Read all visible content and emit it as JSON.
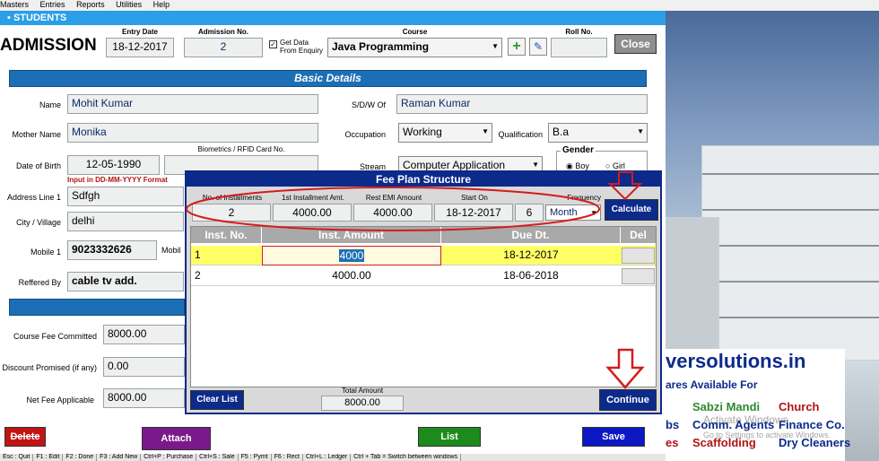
{
  "menu": [
    "Masters",
    "Entries",
    "Reports",
    "Utilities",
    "Help"
  ],
  "window_title": "STUDENTS",
  "form_title": "ADMISSION",
  "header": {
    "entry_date_label": "Entry Date",
    "entry_date": "18-12-2017",
    "admission_no_label": "Admission No.",
    "admission_no": "2",
    "get_data_label": "Get Data\nFrom Enquiry",
    "course_label": "Course",
    "course": "Java Programming",
    "roll_no_label": "Roll No.",
    "roll_no": "",
    "close_label": "Close"
  },
  "basic_details": "Basic Details",
  "fields": {
    "name_label": "Name",
    "name": "Mohit Kumar",
    "sdw_label": "S/D/W Of",
    "sdw": "Raman Kumar",
    "mother_label": "Mother Name",
    "mother": "Monika",
    "occupation_label": "Occupation",
    "occupation": "Working",
    "qualification_label": "Qualification",
    "qualification": "B.a",
    "biometrics_label": "Biometrics / RFID Card No.",
    "dob_label": "Date of Birth",
    "dob": "12-05-1990",
    "dob_hint": "Input in DD-MM-YYYY Format",
    "stream_label": "Stream",
    "stream": "Computer Application",
    "gender_label": "Gender",
    "boy": "Boy",
    "girl": "Girl",
    "address_label": "Address Line 1",
    "address": "Sdfgh",
    "city_label": "City / Village",
    "city": "delhi",
    "mobile_label": "Mobile 1",
    "mobile": "9023332626",
    "mobile2_label": "Mobil",
    "referred_label": "Reffered By",
    "referred": "cable tv add.",
    "fee_committed_label": "Course Fee Committed",
    "fee_committed": "8000.00",
    "discount_label": "Discount Promised (if any)",
    "discount": "0.00",
    "net_fee_label": "Net Fee Applicable",
    "net_fee": "8000.00"
  },
  "modal": {
    "title": "Fee Plan Structure",
    "no_inst_label": "No. of Installments",
    "no_inst": "2",
    "first_amt_label": "1st Installment Amt.",
    "first_amt": "4000.00",
    "rest_emi_label": "Rest EMI Amount",
    "rest_emi": "4000.00",
    "start_on_label": "Start On",
    "start_on": "18-12-2017",
    "frequency_label": "Frequency",
    "frequency_num": "6",
    "frequency_unit": "Month",
    "calculate": "Calculate",
    "cols": [
      "Inst. No.",
      "Inst. Amount",
      "Due Dt.",
      "Del"
    ],
    "rows": [
      {
        "no": "1",
        "amount": "4000",
        "due": "18-12-2017"
      },
      {
        "no": "2",
        "amount": "4000.00",
        "due": "18-06-2018"
      }
    ],
    "clear_list": "Clear List",
    "total_label": "Total Amount",
    "total": "8000.00",
    "continue": "Continue"
  },
  "buttons": {
    "delete": "Delete",
    "attach": "Attach",
    "list": "List",
    "save": "Save"
  },
  "statusbar": [
    "Esc : Quit",
    "F1 : Edit",
    "F2 : Done",
    "F3 : Add New",
    "Ctrl+P : Purchase",
    "Ctrl+S : Sale",
    "F5 : Pymt",
    "F6 : Rect",
    "Ctrl+L : Ledger",
    "Ctrl + Tab = Switch between windows"
  ],
  "ad": {
    "site": "versolutions.in",
    "tag": "ares Available For",
    "items": [
      "Sabzi Mandi",
      "Church",
      "Comm. Agents",
      "Finance Co.",
      "bs",
      "Scaffolding",
      "Dry Cleaners",
      "es"
    ],
    "watermark1": "Activate Windows",
    "watermark2": "Go to Settings to activate Windows."
  },
  "colors": {
    "title_blue": "#2a9ee6",
    "section_blue": "#1c6fb4",
    "modal_blue": "#0c2a8a",
    "highlight_row": "#ffff66",
    "annotation_red": "#d41c1c"
  }
}
